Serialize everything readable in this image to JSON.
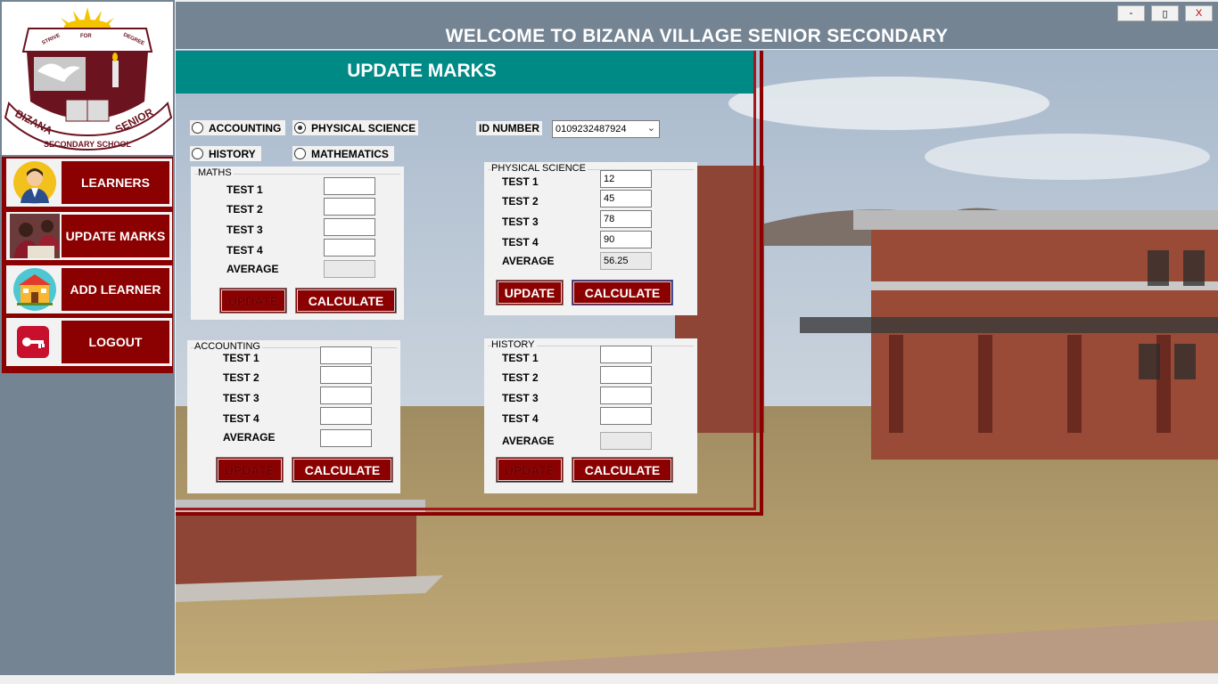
{
  "window": {
    "title": "WELCOME TO BIZANA VILLAGE SENIOR SECONDARY",
    "minimize_label": "-",
    "maximize_label": "▯",
    "close_label": "X"
  },
  "logo": {
    "motto_left": "STRIVE",
    "motto_center": "FOR",
    "motto_right": "DEGREE",
    "ribbon_left": "BIZANA",
    "ribbon_right": "SENIOR",
    "ribbon_bottom": "SECONDARY SCHOOL"
  },
  "sidebar": {
    "items": [
      {
        "label": "LEARNERS",
        "icon": "student-avatar-icon"
      },
      {
        "label": "UPDATE MARKS",
        "icon": "students-photo-icon"
      },
      {
        "label": "ADD LEARNER",
        "icon": "school-building-icon"
      },
      {
        "label": "LOGOUT",
        "icon": "key-icon"
      }
    ]
  },
  "marks": {
    "title": "UPDATE MARKS",
    "subjects": {
      "accounting": "ACCOUNTING",
      "physical_science": "PHYSICAL SCIENCE",
      "history": "HISTORY",
      "mathematics": "MATHEMATICS",
      "selected": "PHYSICAL SCIENCE"
    },
    "id_label": "ID NUMBER",
    "id_value": "0109232487924",
    "groups": {
      "maths": {
        "caption": "MATHS",
        "test1": "",
        "test2": "",
        "test3": "",
        "test4": "",
        "average": ""
      },
      "physical_science": {
        "caption": "PHYSICAL SCIENCE",
        "test1": "12",
        "test2": "45",
        "test3": "78",
        "test4": "90",
        "average": "56.25"
      },
      "accounting": {
        "caption": "ACCOUNTING",
        "test1": "",
        "test2": "",
        "test3": "",
        "test4": "",
        "average": ""
      },
      "history": {
        "caption": "HISTORY",
        "test1": "",
        "test2": "",
        "test3": "",
        "test4": "",
        "average": ""
      }
    },
    "labels": {
      "test1": "TEST 1",
      "test2": "TEST 2",
      "test3": "TEST 3",
      "test4": "TEST 4",
      "average": "AVERAGE"
    },
    "update_label": "UPDATE",
    "calculate_label": "CALCULATE"
  },
  "colors": {
    "maroon": "#8b0000",
    "teal_header": "#008a86",
    "slate": "#758493"
  }
}
